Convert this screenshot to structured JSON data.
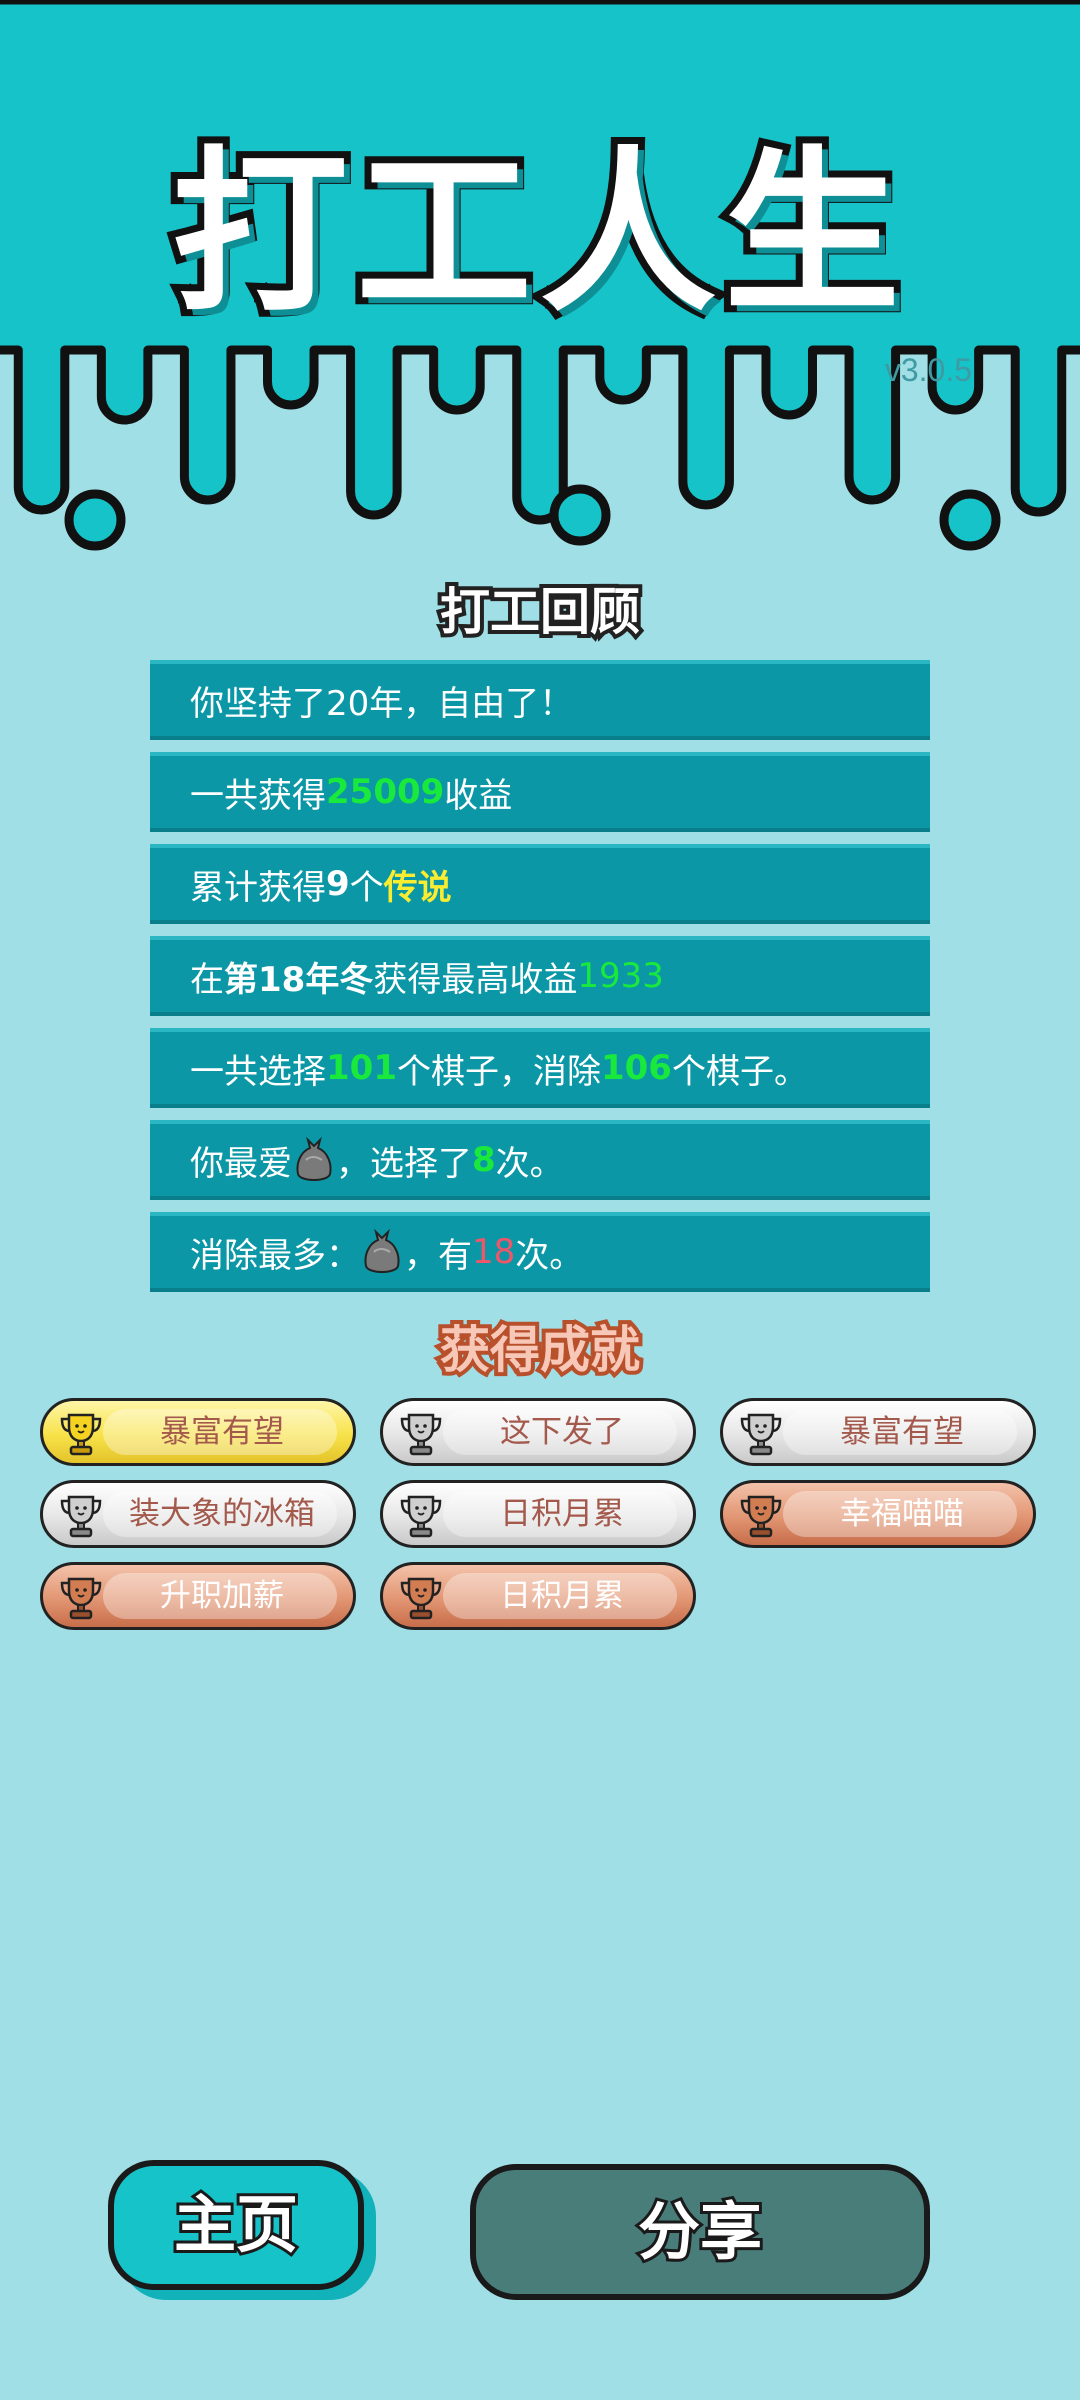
{
  "app": {
    "title": "打工人生",
    "version": "v3.0.5"
  },
  "review": {
    "title": "打工回顾",
    "lines": [
      {
        "parts": [
          "你坚持了20年，自由了！"
        ]
      },
      {
        "parts": [
          "一共获得",
          "25009",
          "收益"
        ]
      },
      {
        "parts": [
          "累计获得",
          "9",
          "个",
          "传说"
        ]
      },
      {
        "parts": [
          "在 ",
          "第18年冬",
          " 获得最高收益",
          "1933"
        ]
      },
      {
        "parts": [
          "一共选择",
          "101",
          "个棋子，消除",
          "106",
          "个棋子。"
        ]
      },
      {
        "parts": [
          "你最爱",
          "，选择了",
          "8",
          "次。"
        ],
        "icon": "garbage-bag-icon"
      },
      {
        "parts": [
          "消除最多：",
          "，有",
          "18",
          "次。"
        ],
        "icon": "garbage-bag-icon"
      }
    ]
  },
  "achievements": {
    "title": "获得成就",
    "items": [
      {
        "label": "暴富有望",
        "tier": "gold"
      },
      {
        "label": "这下发了",
        "tier": "silver"
      },
      {
        "label": "暴富有望",
        "tier": "silver"
      },
      {
        "label": "装大象的冰箱",
        "tier": "silver"
      },
      {
        "label": "日积月累",
        "tier": "silver"
      },
      {
        "label": "幸福喵喵",
        "tier": "bronze"
      },
      {
        "label": "升职加薪",
        "tier": "bronze"
      },
      {
        "label": "日积月累",
        "tier": "bronze"
      }
    ]
  },
  "buttons": {
    "home": "主页",
    "share": "分享"
  },
  "colors": {
    "background": "#a0dfe6",
    "header": "#16c3c8",
    "stat_bar": "#0b97a6",
    "highlight_green": "#19e93c",
    "highlight_yellow": "#f8ed31",
    "highlight_red": "#f0566a",
    "share_button": "#497d7a"
  }
}
